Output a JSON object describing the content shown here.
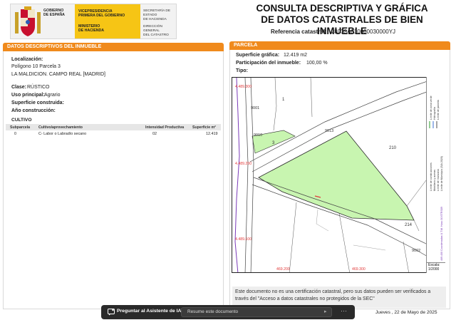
{
  "header": {
    "gobierno": [
      "GOBIERNO",
      "DE ESPAÑA"
    ],
    "vicepresidencia": [
      "VICEPRESIDENCIA",
      "PRIMERA DEL GOBIERNO"
    ],
    "ministerio": [
      "MINISTERIO",
      "DE HACIENDA"
    ],
    "secretaria": [
      "SECRETARÍA DE ESTADO",
      "DE HACIENDA"
    ],
    "direccion": [
      "DIRECCIÓN GENERAL",
      "DEL CATASTRO"
    ],
    "title_line1": "CONSULTA DESCRIPTIVA Y GRÁFICA",
    "title_line2": "DE DATOS CATASTRALES DE BIEN INMUEBLE",
    "ref_label": "Referencia catastral:",
    "ref_value": "28033A010000030000YJ"
  },
  "left": {
    "section_title": "DATOS DESCRIPTIVOS DEL INMUEBLE",
    "localizacion_label": "Localización:",
    "localizacion_line1": "Polígono 10 Parcela 3",
    "localizacion_line2": "LA MALDICION. CAMPO REAL [MADRID]",
    "clase_label": "Clase:",
    "clase_value": "RÚSTICO",
    "uso_label": "Uso principal:",
    "uso_value": "Agrario",
    "superficie_label": "Superficie construida:",
    "anio_label": "Año construcción:",
    "cultivo_title": "CULTIVO",
    "cultivo_headers": [
      "Subparcela",
      "Cultivo/aprovechamiento",
      "Intensidad Productiva",
      "Superficie m²"
    ],
    "cultivo_rows": [
      [
        "0",
        "C- Labor o Labradío secano",
        "02",
        "12.419"
      ]
    ]
  },
  "right": {
    "section_title": "PARCELA",
    "sup_label": "Superficie gráfica:",
    "sup_value": "12.419 m2",
    "part_label": "Participación del inmueble:",
    "part_value": "100,00 %",
    "tipo_label": "Tipo:"
  },
  "map": {
    "labels": {
      "c_top": "4.489.300",
      "c_mid": "4.489.200",
      "c_low": "4.489.100",
      "c_b1": "469.200",
      "c_b2": "469.300",
      "p1": "1",
      "p9001": "9001",
      "p9013": "9013",
      "p3": "3",
      "p210": "210",
      "p214": "214",
      "p9002": "9002",
      "p9010": "9010"
    },
    "legend": [
      "Límite de zona verde",
      "Hidrografía",
      "Límite de parcela",
      "Límite de construcciones",
      "Mobiliario y aceras",
      "Límite de manzana",
      "Límite de Municipio (SIA 2020)",
      "469.400 Coordenadas U.T.M. Huso 30 ETRS89"
    ],
    "escala_label": "Escala:",
    "escala_value": "1/2000",
    "colors": {
      "parcel_fill": "#c8f5b0",
      "parcel_stroke": "#2a2a2a",
      "coord_red": "#e23a3a",
      "hydro": "#7a3ab8"
    }
  },
  "note": {
    "text_line1": "Este documento no es una certificación catastral, pero sus datos pueden ser verificados a",
    "text_line2": "través del \"Acceso a datos catastrales no protegidos de la SEC\""
  },
  "footer": {
    "date": "Jueves , 22 de Mayo de 2025"
  },
  "assistant": {
    "label": "Preguntar al Asistente de IA",
    "placeholder": "Resume este documento",
    "more": "···"
  }
}
